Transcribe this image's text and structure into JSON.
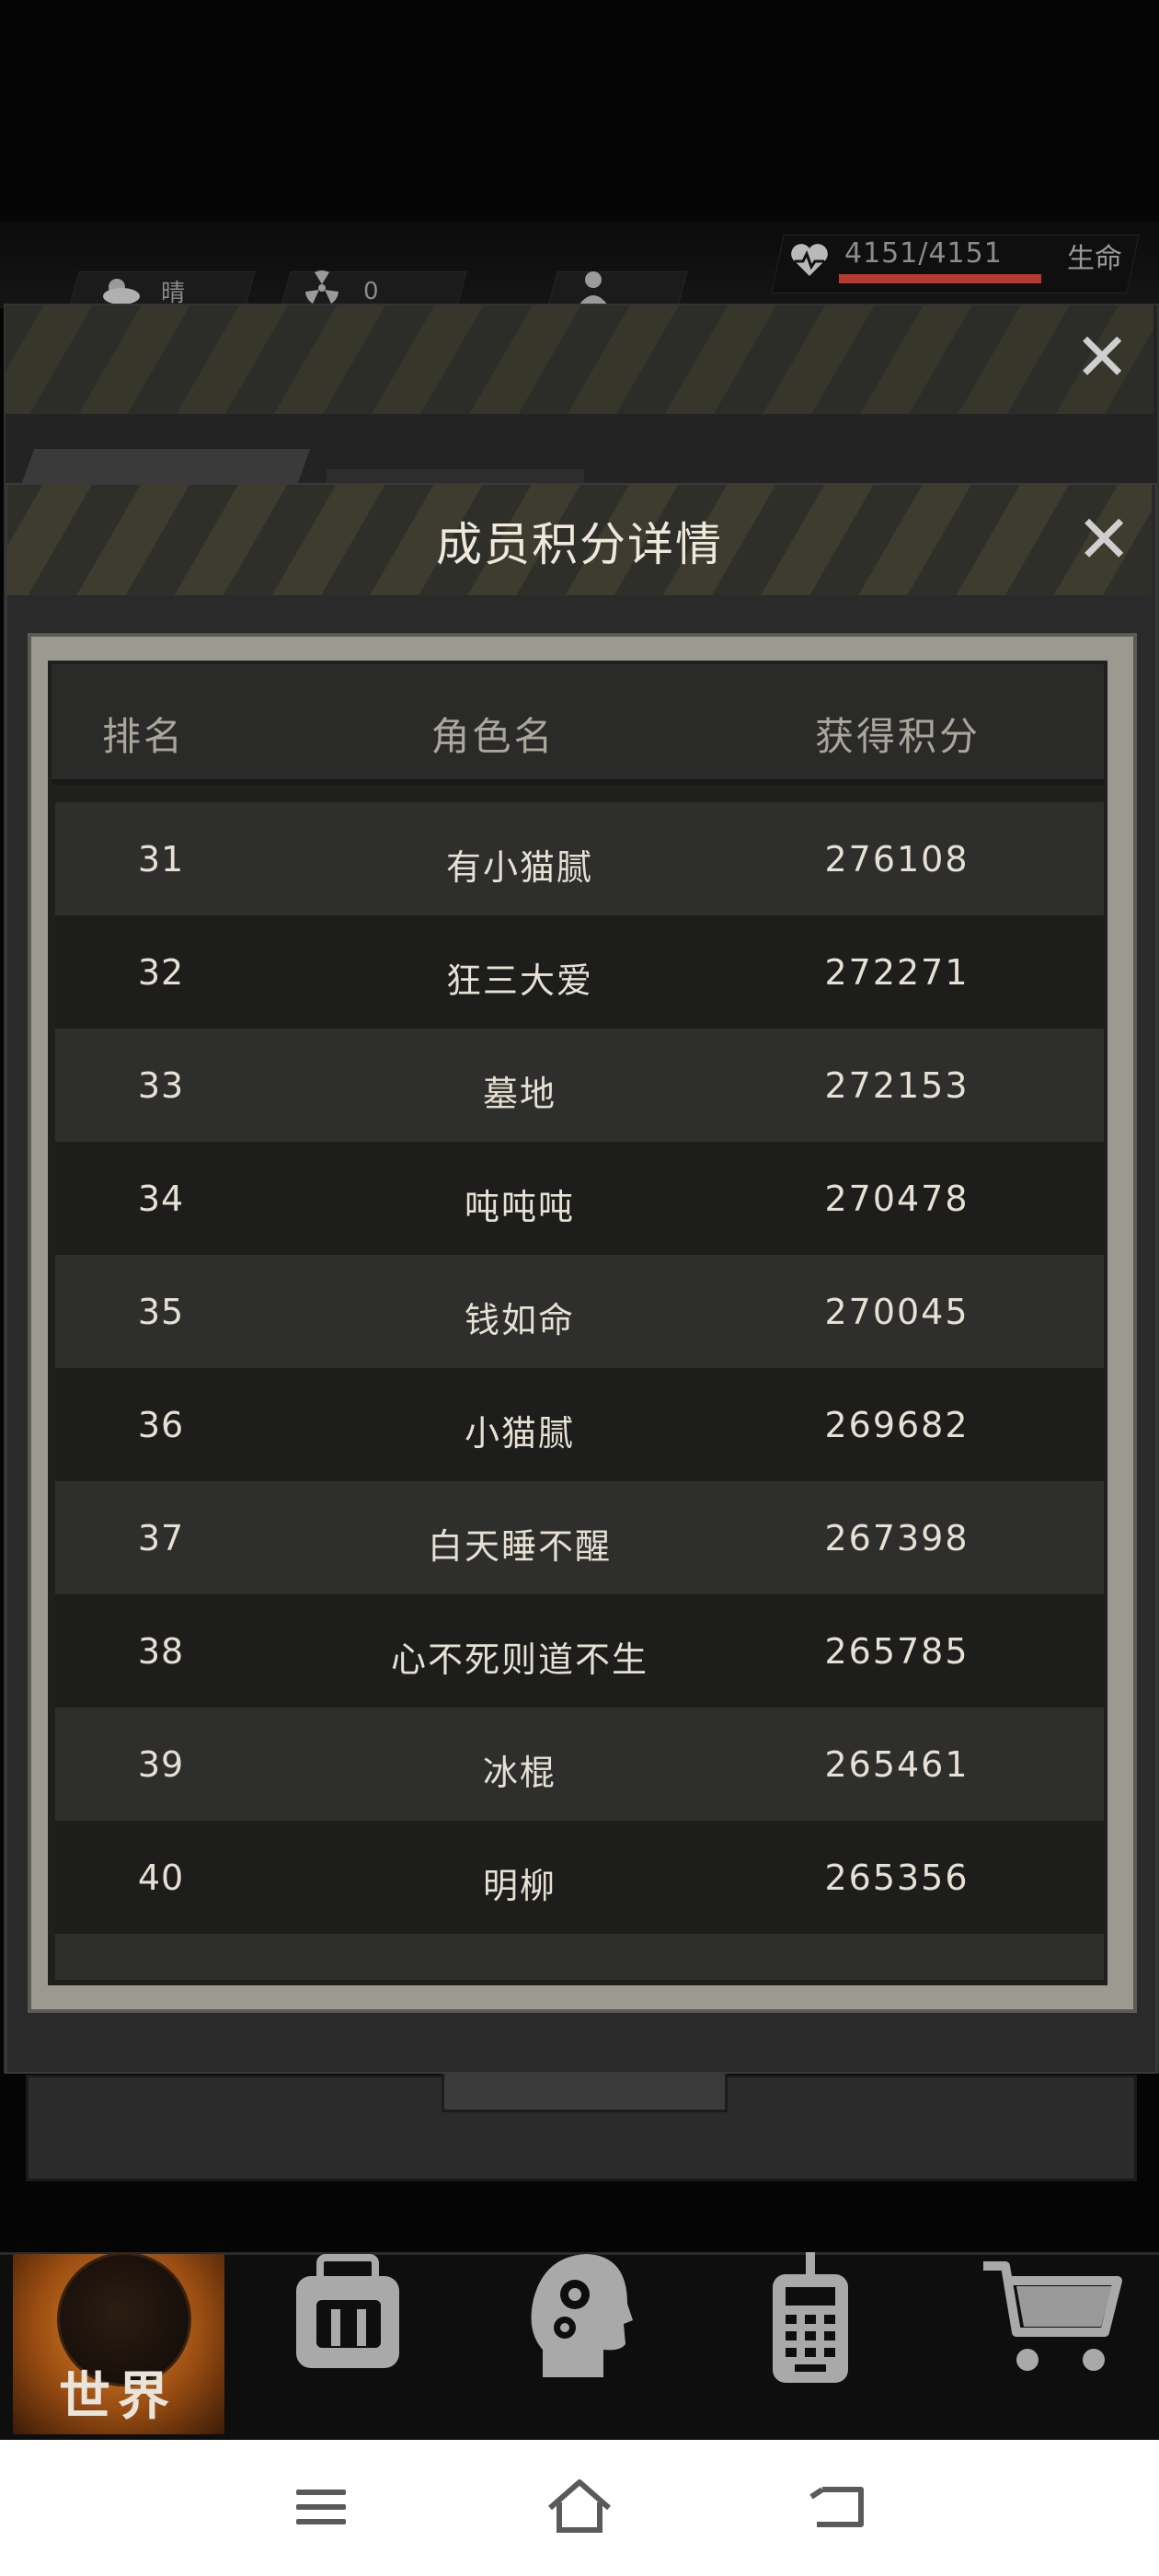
{
  "hud": {
    "weather": "晴",
    "radiation": "0",
    "hp": "4151/4151",
    "hp_label": "生命",
    "hp_fraction": 1.0
  },
  "modal": {
    "title": "成员积分详情",
    "columns": [
      "排名",
      "角色名",
      "获得积分"
    ],
    "rows": [
      {
        "rank": "31",
        "name": "有小猫腻",
        "score": "276108"
      },
      {
        "rank": "32",
        "name": "狂三大爱",
        "score": "272271"
      },
      {
        "rank": "33",
        "name": "墓地",
        "score": "272153"
      },
      {
        "rank": "34",
        "name": "吨吨吨",
        "score": "270478"
      },
      {
        "rank": "35",
        "name": "钱如命",
        "score": "270045"
      },
      {
        "rank": "36",
        "name": "小猫腻",
        "score": "269682"
      },
      {
        "rank": "37",
        "name": "白天睡不醒",
        "score": "267398"
      },
      {
        "rank": "38",
        "name": "心不死则道不生",
        "score": "265785"
      },
      {
        "rank": "39",
        "name": "冰棍",
        "score": "265461"
      },
      {
        "rank": "40",
        "name": "明柳",
        "score": "265356"
      }
    ]
  },
  "game_nav": {
    "world_label": "世界",
    "items": [
      "world",
      "backpack-icon",
      "skills-head-icon",
      "radio-icon",
      "cart-icon"
    ]
  },
  "colors": {
    "accent_orange": "#e08a2a",
    "hp_red": "#b8392e",
    "stripe_yellow": "#3e3c2e"
  }
}
